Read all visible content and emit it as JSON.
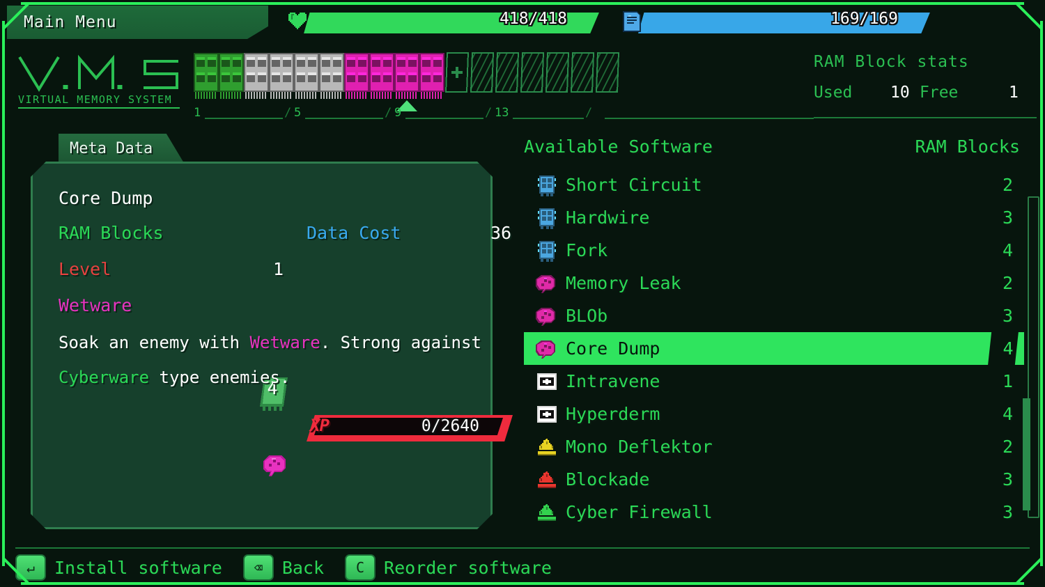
{
  "header": {
    "menu_label": "Main Menu",
    "health": {
      "icon": "heart-icon",
      "current": 418,
      "max": 418,
      "display": "418/418",
      "color": "#31d95b"
    },
    "data": {
      "icon": "data-disk-icon",
      "current": 169,
      "max": 169,
      "display": "169/169",
      "color": "#38a7e8"
    }
  },
  "logo": {
    "title": "V.M.S",
    "subtitle": "VIRTUAL MEMORY SYSTEM"
  },
  "ram_strip": {
    "slot_labels": [
      "1",
      "5",
      "9",
      "13"
    ],
    "add_slot_symbol": "+",
    "sticks": [
      {
        "color": "#2f9e2f",
        "type": "green"
      },
      {
        "color": "#2f9e2f",
        "type": "green"
      },
      {
        "color": "#b8b8b8",
        "type": "gray"
      },
      {
        "color": "#b8b8b8",
        "type": "gray"
      },
      {
        "color": "#b8b8b8",
        "type": "gray"
      },
      {
        "color": "#b8b8b8",
        "type": "gray"
      },
      {
        "color": "#e020b0",
        "type": "magenta"
      },
      {
        "color": "#e020b0",
        "type": "magenta"
      },
      {
        "color": "#e020b0",
        "type": "magenta"
      },
      {
        "color": "#e020b0",
        "type": "magenta"
      }
    ],
    "marker_slot_index": 8,
    "empty_slots": 6
  },
  "ram_stats": {
    "title": "RAM Block stats",
    "used_label": "Used",
    "used_value": "10",
    "free_label": "Free",
    "free_value": "1"
  },
  "meta": {
    "tab_label": "Meta Data",
    "name": "Core Dump",
    "ram_blocks_label": "RAM Blocks",
    "ram_blocks_value": "4",
    "data_cost_label": "Data Cost",
    "data_cost_value": "36",
    "level_label": "Level",
    "level_value": "1",
    "type_label": "Wetware",
    "type_icon": "brain-icon",
    "xp_label": "XP",
    "xp_value": "0/2640",
    "xp_percent": 0,
    "desc_line1_a": "Soak an enemy with ",
    "desc_line1_b": "Wetware",
    "desc_line1_c": ". Strong against",
    "desc_line2_a": "Cyberware",
    "desc_line2_b": " type enemies."
  },
  "software": {
    "header_left": "Available Software",
    "header_right": "RAM Blocks",
    "items": [
      {
        "name": "Short Circuit",
        "blocks": "2",
        "icon": "chip-icon",
        "icon_color": "#4ba7e0",
        "selected": false
      },
      {
        "name": "Hardwire",
        "blocks": "3",
        "icon": "chip-icon",
        "icon_color": "#4ba7e0",
        "selected": false
      },
      {
        "name": "Fork",
        "blocks": "4",
        "icon": "chip-icon",
        "icon_color": "#4ba7e0",
        "selected": false
      },
      {
        "name": "Memory Leak",
        "blocks": "2",
        "icon": "brain-icon",
        "icon_color": "#e02aa8",
        "selected": false
      },
      {
        "name": "BLOb",
        "blocks": "3",
        "icon": "brain-icon",
        "icon_color": "#e02aa8",
        "selected": false
      },
      {
        "name": "Core Dump",
        "blocks": "4",
        "icon": "brain-icon",
        "icon_color": "#e02aa8",
        "selected": true
      },
      {
        "name": "Intravene",
        "blocks": "1",
        "icon": "medkit-icon",
        "icon_color": "#ffffff",
        "selected": false
      },
      {
        "name": "Hyperderm",
        "blocks": "4",
        "icon": "medkit-icon",
        "icon_color": "#ffffff",
        "selected": false
      },
      {
        "name": "Mono Deflektor",
        "blocks": "2",
        "icon": "shield-icon",
        "icon_color": "#e8d322",
        "selected": false
      },
      {
        "name": "Blockade",
        "blocks": "3",
        "icon": "shield-icon",
        "icon_color": "#e8362e",
        "selected": false
      },
      {
        "name": "Cyber Firewall",
        "blocks": "3",
        "icon": "shield-icon",
        "icon_color": "#33d14e",
        "selected": false
      }
    ]
  },
  "footer": {
    "actions": [
      {
        "key": "↵",
        "key_name": "enter-key",
        "label": "Install software"
      },
      {
        "key": "⌫",
        "key_name": "backspace-key",
        "label": "Back"
      },
      {
        "key": "C",
        "key_name": "c-key",
        "label": "Reorder software"
      }
    ]
  },
  "colors": {
    "accent_green": "#2bd957",
    "bright_green": "#2fe45e",
    "panel_green": "#16402c",
    "bg": "#07150d",
    "pink": "#e832c0",
    "red": "#e8413f",
    "blue": "#39a9ee"
  }
}
